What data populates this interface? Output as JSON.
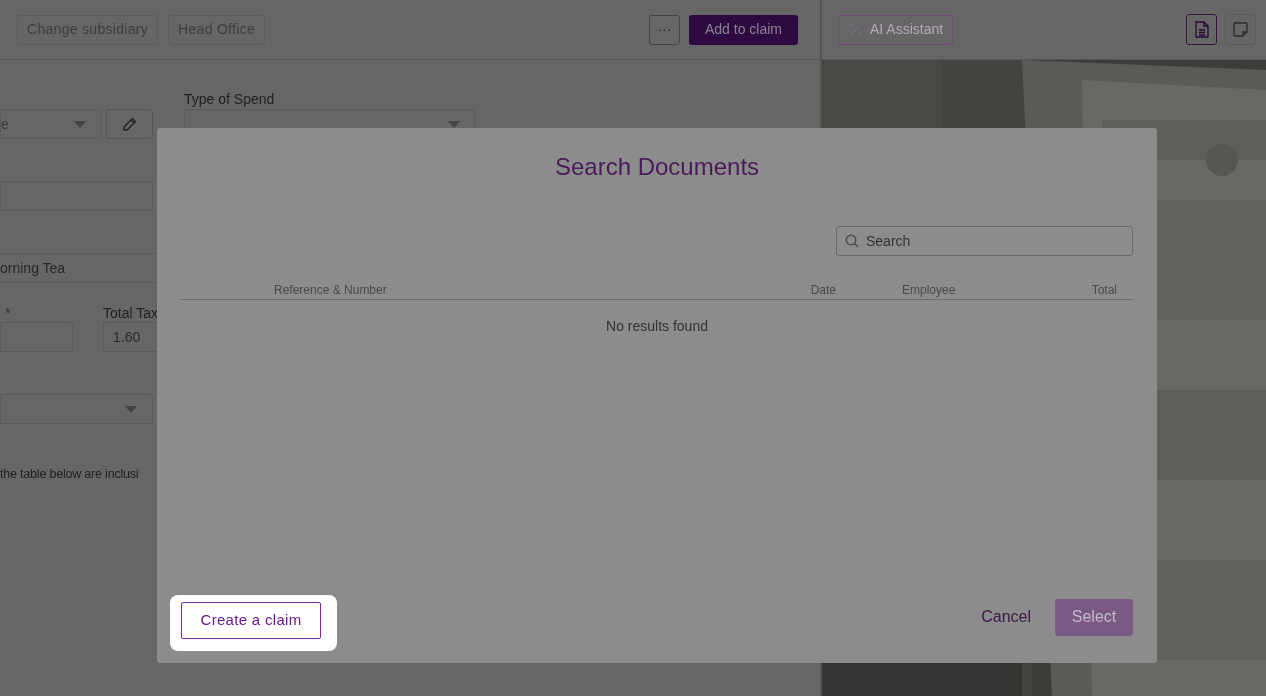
{
  "header": {
    "buttons": [
      {
        "label": "Change subsidiary"
      },
      {
        "label": "Head Office"
      }
    ],
    "more_button": "···",
    "primary_button": "Add to claim"
  },
  "form": {
    "category_select": {
      "value": "e"
    },
    "type_of_spend": {
      "label": "Type of Spend"
    },
    "description": {
      "value": "orning Tea"
    },
    "amount": {
      "label": "*"
    },
    "total_tax": {
      "label": "Total Tax",
      "value": "1.60"
    },
    "note": "the table below are inclusi"
  },
  "document_panel": {
    "ai_button": "AI Assistant",
    "view_toggles": [
      {
        "kind": "document",
        "selected": true
      },
      {
        "kind": "note",
        "selected": false
      }
    ]
  },
  "modal": {
    "title": "Search Documents",
    "search": {
      "placeholder": "Search"
    },
    "columns": [
      "Reference & Number",
      "Date",
      "Employee",
      "Total"
    ],
    "empty_message": "No results found",
    "create_button": "Create a claim",
    "cancel_button": "Cancel",
    "select_button": {
      "label": "Select",
      "disabled": true
    }
  }
}
